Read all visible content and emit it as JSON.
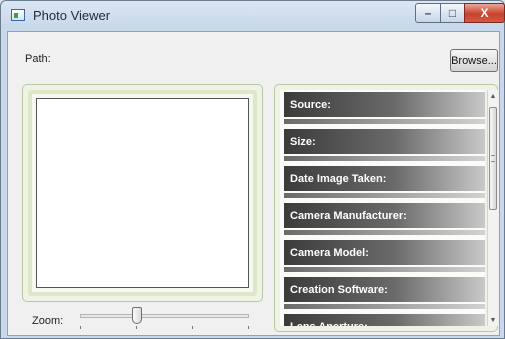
{
  "window": {
    "title": "Photo Viewer"
  },
  "caption_buttons": {
    "minimize": "–",
    "maximize": "□",
    "close": "X"
  },
  "path": {
    "label": "Path:",
    "browse_label": "Browse..."
  },
  "zoom": {
    "label": "Zoom:",
    "level": 0.33
  },
  "info_fields": [
    "Source:",
    "Size:",
    "Date Image Taken:",
    "Camera Manufacturer:",
    "Camera Model:",
    "Creation Software:",
    "Lens Aperture:"
  ],
  "scrollbar": {
    "up_arrow": "▲",
    "down_arrow": "▼"
  }
}
